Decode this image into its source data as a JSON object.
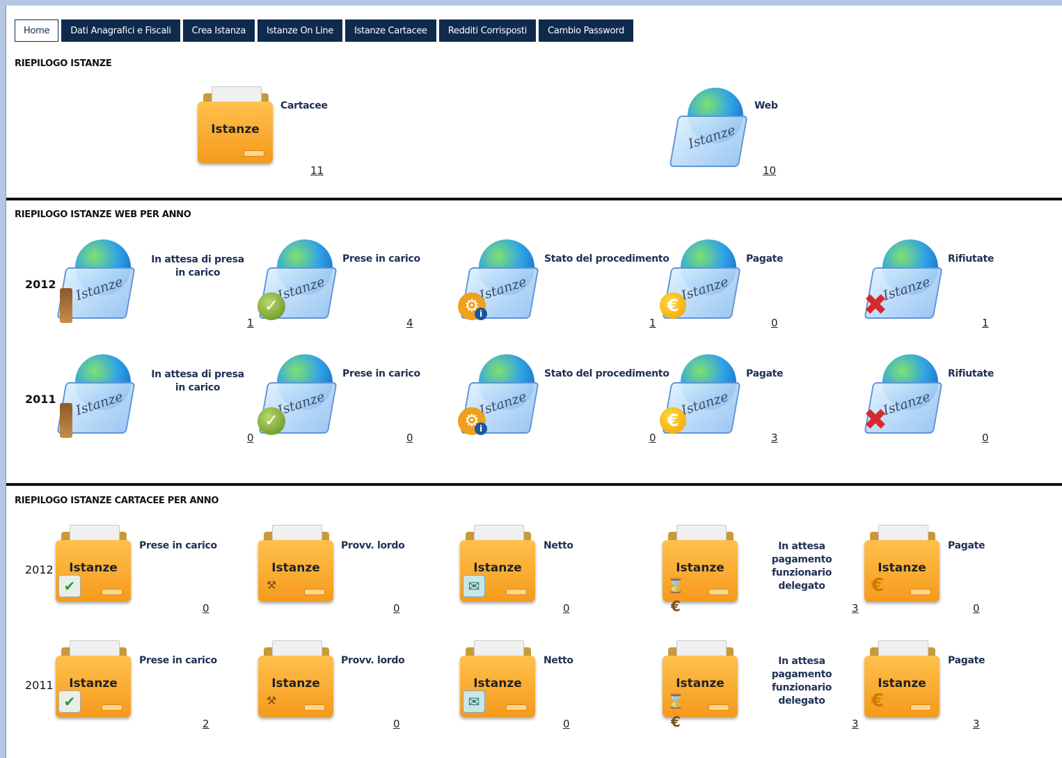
{
  "nav": {
    "tabs": [
      {
        "label": "Home",
        "active": true
      },
      {
        "label": "Dati Anagrafici e Fiscali"
      },
      {
        "label": "Crea Istanza"
      },
      {
        "label": "Istanze On Line"
      },
      {
        "label": "Istanze Cartacee"
      },
      {
        "label": "Redditi Corrisposti"
      },
      {
        "label": "Cambio Password"
      }
    ]
  },
  "riepilogo": {
    "title": "RIEPILOGO ISTANZE",
    "cartacee": {
      "icon_text": "Istanze",
      "label": "Cartacee",
      "count": "11"
    },
    "web": {
      "icon_text": "Istanze",
      "label": "Web",
      "count": "10"
    }
  },
  "web_per_anno": {
    "title": "RIEPILOGO ISTANZE WEB PER ANNO",
    "icon_text": "Istanze",
    "rows": [
      {
        "year": "2012",
        "items": [
          {
            "label": "In attesa di presa in carico",
            "count": "1",
            "icon": "hourglass-icon"
          },
          {
            "label": "Prese in carico",
            "count": "4",
            "icon": "check-icon"
          },
          {
            "label": "Stato del procedimento",
            "count": "1",
            "icon": "gear-info-icon"
          },
          {
            "label": "Pagate",
            "count": "0",
            "icon": "euro-icon"
          },
          {
            "label": "Rifiutate",
            "count": "1",
            "icon": "red-x-icon"
          }
        ]
      },
      {
        "year": "2011",
        "items": [
          {
            "label": "In attesa di presa in carico",
            "count": "0",
            "icon": "hourglass-icon"
          },
          {
            "label": "Prese in carico",
            "count": "0",
            "icon": "check-icon"
          },
          {
            "label": "Stato del procedimento",
            "count": "0",
            "icon": "gear-info-icon"
          },
          {
            "label": "Pagate",
            "count": "3",
            "icon": "euro-icon"
          },
          {
            "label": "Rifiutate",
            "count": "0",
            "icon": "red-x-icon"
          }
        ]
      }
    ]
  },
  "cartacee_per_anno": {
    "title": "RIEPILOGO ISTANZE CARTACEE PER ANNO",
    "icon_text": "Istanze",
    "rows": [
      {
        "year": "2012",
        "items": [
          {
            "label": "Prese in carico",
            "count": "0",
            "icon": "document-check-icon"
          },
          {
            "label": "Provv. lordo",
            "count": "0",
            "icon": "gavel-icon"
          },
          {
            "label": "Netto",
            "count": "0",
            "icon": "mail-icon"
          },
          {
            "label": "In attesa pagamento funzionario delegato",
            "count": "3",
            "icon": "hourglass-euro-icon"
          },
          {
            "label": "Pagate",
            "count": "0",
            "icon": "euro-icon"
          }
        ]
      },
      {
        "year": "2011",
        "items": [
          {
            "label": "Prese in carico",
            "count": "2",
            "icon": "document-check-icon"
          },
          {
            "label": "Provv. lordo",
            "count": "0",
            "icon": "gavel-icon"
          },
          {
            "label": "Netto",
            "count": "0",
            "icon": "mail-icon"
          },
          {
            "label": "In attesa pagamento funzionario delegato",
            "count": "3",
            "icon": "hourglass-euro-icon"
          },
          {
            "label": "Pagate",
            "count": "3",
            "icon": "euro-icon"
          }
        ]
      }
    ]
  }
}
